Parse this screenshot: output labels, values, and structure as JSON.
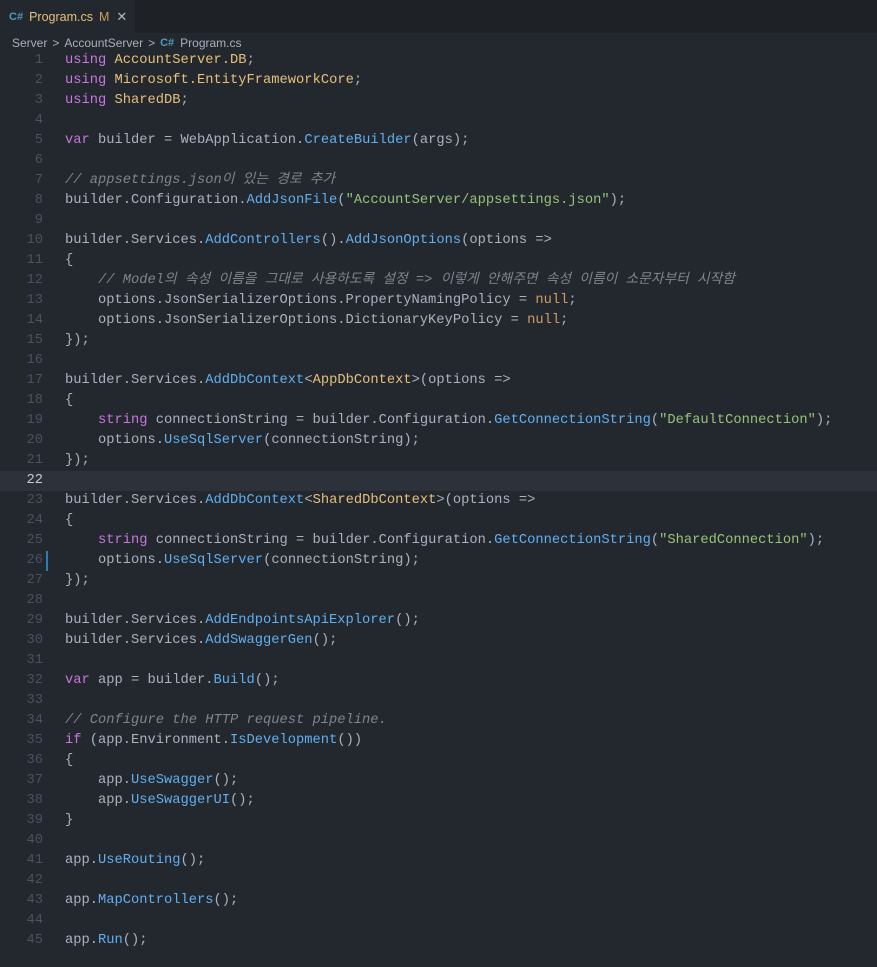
{
  "tab": {
    "icon": "C#",
    "label": "Program.cs",
    "modified": "M",
    "close": "✕"
  },
  "breadcrumb": [
    "Server",
    "AccountServer",
    "Program.cs"
  ],
  "breadcrumb_sep": ">",
  "colors": {
    "keyword": "#c678dd",
    "type": "#e5c07b",
    "function": "#61afef",
    "string": "#98c379",
    "comment": "#7f848e",
    "number": "#d19a66"
  },
  "current_line": 22,
  "modified_line": 26,
  "lines": [
    [
      [
        "kw",
        "using"
      ],
      [
        "pl",
        " "
      ],
      [
        "ty",
        "AccountServer.DB"
      ],
      [
        "pl",
        ";"
      ]
    ],
    [
      [
        "kw",
        "using"
      ],
      [
        "pl",
        " "
      ],
      [
        "ty",
        "Microsoft.EntityFrameworkCore"
      ],
      [
        "pl",
        ";"
      ]
    ],
    [
      [
        "kw",
        "using"
      ],
      [
        "pl",
        " "
      ],
      [
        "ty",
        "SharedDB"
      ],
      [
        "pl",
        ";"
      ]
    ],
    [],
    [
      [
        "kw",
        "var"
      ],
      [
        "pl",
        " builder = WebApplication."
      ],
      [
        "fn",
        "CreateBuilder"
      ],
      [
        "pl",
        "(args);"
      ]
    ],
    [],
    [
      [
        "cm",
        "// appsettings.json이 있는 경로 추가"
      ]
    ],
    [
      [
        "pl",
        "builder.Configuration."
      ],
      [
        "fn",
        "AddJsonFile"
      ],
      [
        "pl",
        "("
      ],
      [
        "st",
        "\"AccountServer/appsettings.json\""
      ],
      [
        "pl",
        ");"
      ]
    ],
    [],
    [
      [
        "pl",
        "builder.Services."
      ],
      [
        "fn",
        "AddControllers"
      ],
      [
        "pl",
        "()."
      ],
      [
        "fn",
        "AddJsonOptions"
      ],
      [
        "pl",
        "(options =>"
      ]
    ],
    [
      [
        "pl",
        "{"
      ]
    ],
    [
      [
        "pl",
        "    "
      ],
      [
        "cm",
        "// Model의 속성 이름을 그대로 사용하도록 설정 => 이렇게 안해주면 속성 이름이 소문자부터 시작함"
      ]
    ],
    [
      [
        "pl",
        "    options.JsonSerializerOptions.PropertyNamingPolicy = "
      ],
      [
        "nu",
        "null"
      ],
      [
        "pl",
        ";"
      ]
    ],
    [
      [
        "pl",
        "    options.JsonSerializerOptions.DictionaryKeyPolicy = "
      ],
      [
        "nu",
        "null"
      ],
      [
        "pl",
        ";"
      ]
    ],
    [
      [
        "pl",
        "});"
      ]
    ],
    [],
    [
      [
        "pl",
        "builder.Services."
      ],
      [
        "fn",
        "AddDbContext"
      ],
      [
        "pl",
        "<"
      ],
      [
        "ty",
        "AppDbContext"
      ],
      [
        "pl",
        ">(options =>"
      ]
    ],
    [
      [
        "pl",
        "{"
      ]
    ],
    [
      [
        "pl",
        "    "
      ],
      [
        "kw",
        "string"
      ],
      [
        "pl",
        " connectionString = builder.Configuration."
      ],
      [
        "fn",
        "GetConnectionString"
      ],
      [
        "pl",
        "("
      ],
      [
        "st",
        "\"DefaultConnection\""
      ],
      [
        "pl",
        ");"
      ]
    ],
    [
      [
        "pl",
        "    options."
      ],
      [
        "fn",
        "UseSqlServer"
      ],
      [
        "pl",
        "(connectionString);"
      ]
    ],
    [
      [
        "pl",
        "});"
      ]
    ],
    [],
    [
      [
        "pl",
        "builder.Services."
      ],
      [
        "fn",
        "AddDbContext"
      ],
      [
        "pl",
        "<"
      ],
      [
        "ty",
        "SharedDbContext"
      ],
      [
        "pl",
        ">(options =>"
      ]
    ],
    [
      [
        "pl",
        "{"
      ]
    ],
    [
      [
        "pl",
        "    "
      ],
      [
        "kw",
        "string"
      ],
      [
        "pl",
        " connectionString = builder.Configuration."
      ],
      [
        "fn",
        "GetConnectionString"
      ],
      [
        "pl",
        "("
      ],
      [
        "st",
        "\"SharedConnection\""
      ],
      [
        "pl",
        ");"
      ]
    ],
    [
      [
        "pl",
        "    options."
      ],
      [
        "fn",
        "UseSqlServer"
      ],
      [
        "pl",
        "(connectionString);"
      ]
    ],
    [
      [
        "pl",
        "});"
      ]
    ],
    [],
    [
      [
        "pl",
        "builder.Services."
      ],
      [
        "fn",
        "AddEndpointsApiExplorer"
      ],
      [
        "pl",
        "();"
      ]
    ],
    [
      [
        "pl",
        "builder.Services."
      ],
      [
        "fn",
        "AddSwaggerGen"
      ],
      [
        "pl",
        "();"
      ]
    ],
    [],
    [
      [
        "kw",
        "var"
      ],
      [
        "pl",
        " app = builder."
      ],
      [
        "fn",
        "Build"
      ],
      [
        "pl",
        "();"
      ]
    ],
    [],
    [
      [
        "cm",
        "// Configure the HTTP request pipeline."
      ]
    ],
    [
      [
        "kw",
        "if"
      ],
      [
        "pl",
        " (app.Environment."
      ],
      [
        "fn",
        "IsDevelopment"
      ],
      [
        "pl",
        "())"
      ]
    ],
    [
      [
        "pl",
        "{"
      ]
    ],
    [
      [
        "pl",
        "    app."
      ],
      [
        "fn",
        "UseSwagger"
      ],
      [
        "pl",
        "();"
      ]
    ],
    [
      [
        "pl",
        "    app."
      ],
      [
        "fn",
        "UseSwaggerUI"
      ],
      [
        "pl",
        "();"
      ]
    ],
    [
      [
        "pl",
        "}"
      ]
    ],
    [],
    [
      [
        "pl",
        "app."
      ],
      [
        "fn",
        "UseRouting"
      ],
      [
        "pl",
        "();"
      ]
    ],
    [],
    [
      [
        "pl",
        "app."
      ],
      [
        "fn",
        "MapControllers"
      ],
      [
        "pl",
        "();"
      ]
    ],
    [],
    [
      [
        "pl",
        "app."
      ],
      [
        "fn",
        "Run"
      ],
      [
        "pl",
        "();"
      ]
    ]
  ]
}
